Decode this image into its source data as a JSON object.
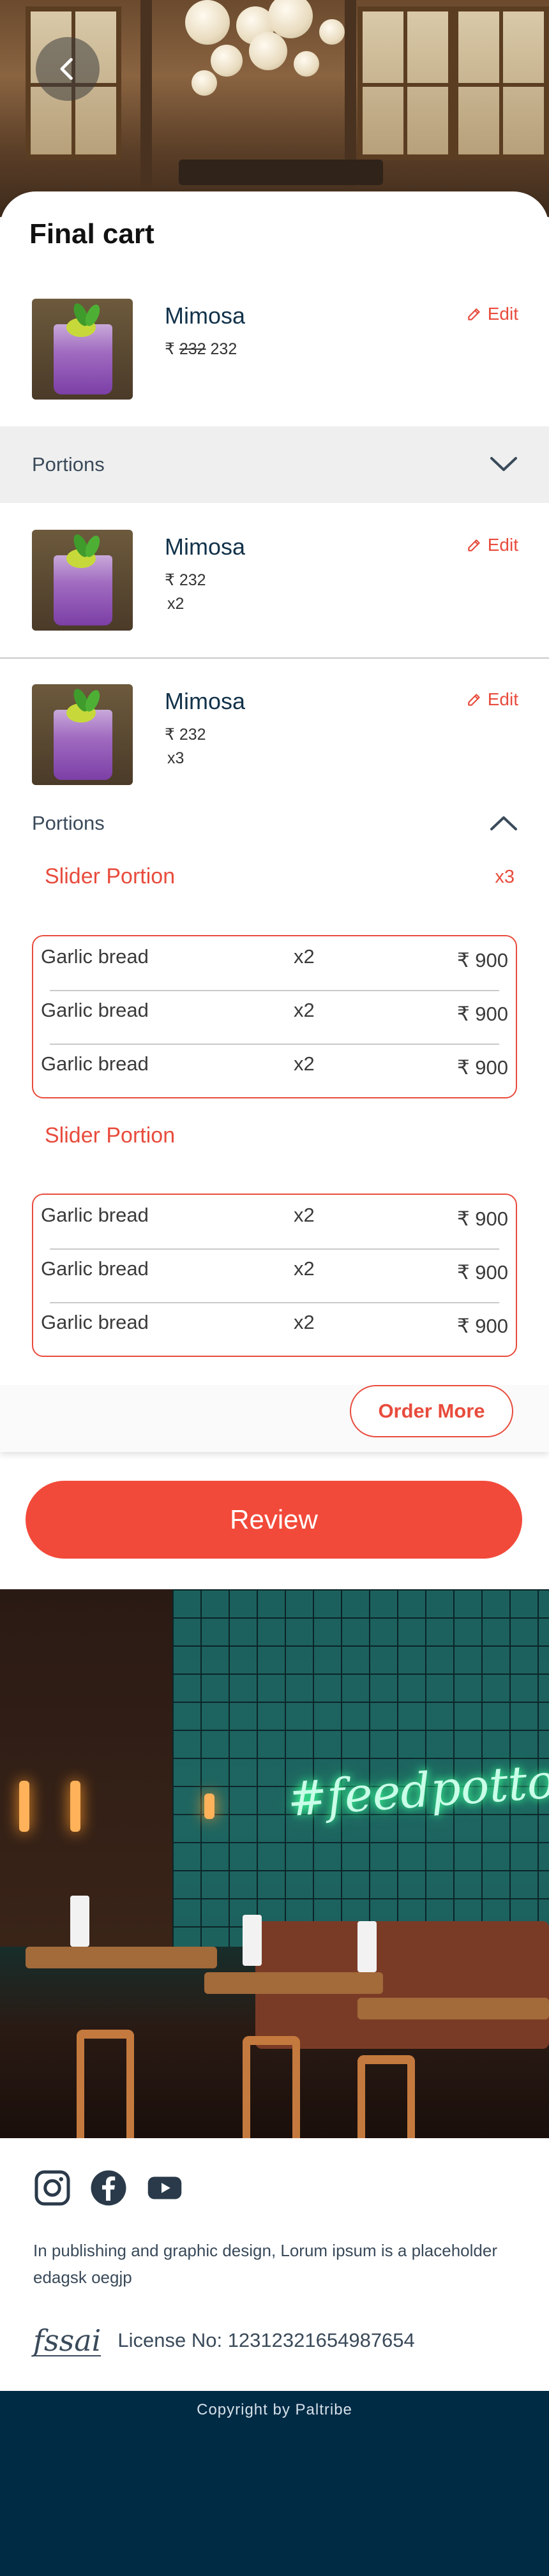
{
  "header": {
    "back_icon": "chevron-left-icon"
  },
  "cart": {
    "title": "Final cart",
    "items": [
      {
        "name": "Mimosa",
        "currency": "₹",
        "original_price": "232",
        "price": "232",
        "edit_label": "Edit"
      },
      {
        "name": "Mimosa",
        "currency": "₹",
        "price": "232",
        "qty": "x2",
        "edit_label": "Edit"
      },
      {
        "name": "Mimosa",
        "currency": "₹",
        "price": "232",
        "qty": "x3",
        "edit_label": "Edit"
      }
    ],
    "portions_label": "Portions",
    "portions_open_label": "Portions",
    "portion_groups": [
      {
        "title": "Slider Portion",
        "count": "x3",
        "rows": [
          {
            "name": "Garlic bread",
            "qty": "x2",
            "price": "₹ 900"
          },
          {
            "name": "Garlic bread",
            "qty": "x2",
            "price": "₹ 900"
          },
          {
            "name": "Garlic bread",
            "qty": "x2",
            "price": "₹ 900"
          }
        ]
      },
      {
        "title": "Slider Portion",
        "rows": [
          {
            "name": "Garlic bread",
            "qty": "x2",
            "price": "₹ 900"
          },
          {
            "name": "Garlic bread",
            "qty": "x2",
            "price": "₹ 900"
          },
          {
            "name": "Garlic bread",
            "qty": "x2",
            "price": "₹ 900"
          }
        ]
      }
    ],
    "order_more_label": "Order More"
  },
  "review_label": "Review",
  "neon_sign": "#feedpottom",
  "footer": {
    "social_icons": [
      "instagram-icon",
      "facebook-icon",
      "youtube-icon"
    ],
    "description": "In publishing and graphic design, Lorum ipsum is a placeholder edagsk oegjp",
    "fssai_logo": "fssai",
    "license": "License No: 12312321654987654",
    "copyright": "Copyright by Paltribe"
  },
  "colors": {
    "accent": "#e84b3c",
    "review_button": "#f24a3a",
    "footer_bg": "#002b45",
    "portions_bg": "#efefef"
  }
}
